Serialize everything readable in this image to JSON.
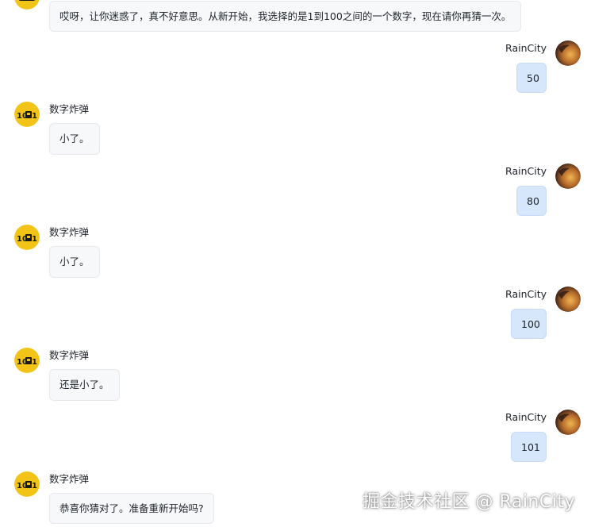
{
  "colors": {
    "bot_bubble": "#f6f8fa",
    "user_bubble": "#d6e6fb",
    "bot_avatar_bg": "#f2c418",
    "bot_avatar_ink": "#1a1a1a"
  },
  "bot_name": "数字炸弹",
  "user_name": "RainCity",
  "bot_avatar_text": "1001",
  "messages": [
    {
      "role": "bot",
      "text": "哎呀，让你迷惑了，真不好意思。从新开始，我选择的是1到100之间的一个数字，现在请你再猜一次。"
    },
    {
      "role": "user",
      "name": "RainCity",
      "text": "50"
    },
    {
      "role": "bot",
      "name": "数字炸弹",
      "text": "小了。"
    },
    {
      "role": "user",
      "name": "RainCity",
      "text": "80"
    },
    {
      "role": "bot",
      "name": "数字炸弹",
      "text": "小了。"
    },
    {
      "role": "user",
      "name": "RainCity",
      "text": "100"
    },
    {
      "role": "bot",
      "name": "数字炸弹",
      "text": "还是小了。"
    },
    {
      "role": "user",
      "name": "RainCity",
      "text": "101"
    },
    {
      "role": "bot",
      "name": "数字炸弹",
      "text": "恭喜你猜对了。准备重新开始吗?"
    }
  ],
  "watermark": "掘金技术社区 @ RainCity"
}
